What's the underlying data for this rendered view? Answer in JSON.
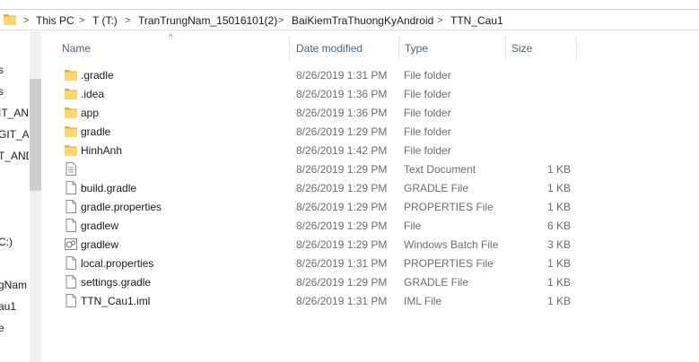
{
  "breadcrumb": [
    "This PC",
    "T (T:)",
    "TranTrungNam_15016101(2)",
    "BaiKiemTraThuongKyAndroid",
    "TTN_Cau1"
  ],
  "nav": {
    "items": [
      "s",
      "s",
      "IT_AND",
      "GIT_AN",
      "T_AND",
      "C:)",
      "gNam",
      "au1",
      "e"
    ]
  },
  "columns": {
    "name": "Name",
    "date": "Date modified",
    "type": "Type",
    "size": "Size"
  },
  "files": [
    {
      "name": ".gradle",
      "date": "8/26/2019 1:31 PM",
      "type": "File folder",
      "size": "",
      "icon": "folder-icon"
    },
    {
      "name": ".idea",
      "date": "8/26/2019 1:36 PM",
      "type": "File folder",
      "size": "",
      "icon": "folder-icon"
    },
    {
      "name": "app",
      "date": "8/26/2019 1:36 PM",
      "type": "File folder",
      "size": "",
      "icon": "folder-icon"
    },
    {
      "name": "gradle",
      "date": "8/26/2019 1:29 PM",
      "type": "File folder",
      "size": "",
      "icon": "folder-icon"
    },
    {
      "name": "HinhAnh",
      "date": "8/26/2019 1:42 PM",
      "type": "File folder",
      "size": "",
      "icon": "folder-icon"
    },
    {
      "name": "",
      "date": "8/26/2019 1:29 PM",
      "type": "Text Document",
      "size": "1 KB",
      "icon": "text-document-icon"
    },
    {
      "name": "build.gradle",
      "date": "8/26/2019 1:29 PM",
      "type": "GRADLE File",
      "size": "1 KB",
      "icon": "file-icon"
    },
    {
      "name": "gradle.properties",
      "date": "8/26/2019 1:29 PM",
      "type": "PROPERTIES File",
      "size": "1 KB",
      "icon": "file-icon"
    },
    {
      "name": "gradlew",
      "date": "8/26/2019 1:29 PM",
      "type": "File",
      "size": "6 KB",
      "icon": "file-icon"
    },
    {
      "name": "gradlew",
      "date": "8/26/2019 1:29 PM",
      "type": "Windows Batch File",
      "size": "3 KB",
      "icon": "batch-file-icon"
    },
    {
      "name": "local.properties",
      "date": "8/26/2019 1:31 PM",
      "type": "PROPERTIES File",
      "size": "1 KB",
      "icon": "file-icon"
    },
    {
      "name": "settings.gradle",
      "date": "8/26/2019 1:29 PM",
      "type": "GRADLE File",
      "size": "1 KB",
      "icon": "file-icon"
    },
    {
      "name": "TTN_Cau1.iml",
      "date": "8/26/2019 1:31 PM",
      "type": "IML File",
      "size": "1 KB",
      "icon": "file-icon"
    }
  ],
  "colors": {
    "folder": "#f8d775",
    "folder_dark": "#e0b03c",
    "header_text": "#4c607a",
    "secondary_text": "#6d6d6d"
  }
}
